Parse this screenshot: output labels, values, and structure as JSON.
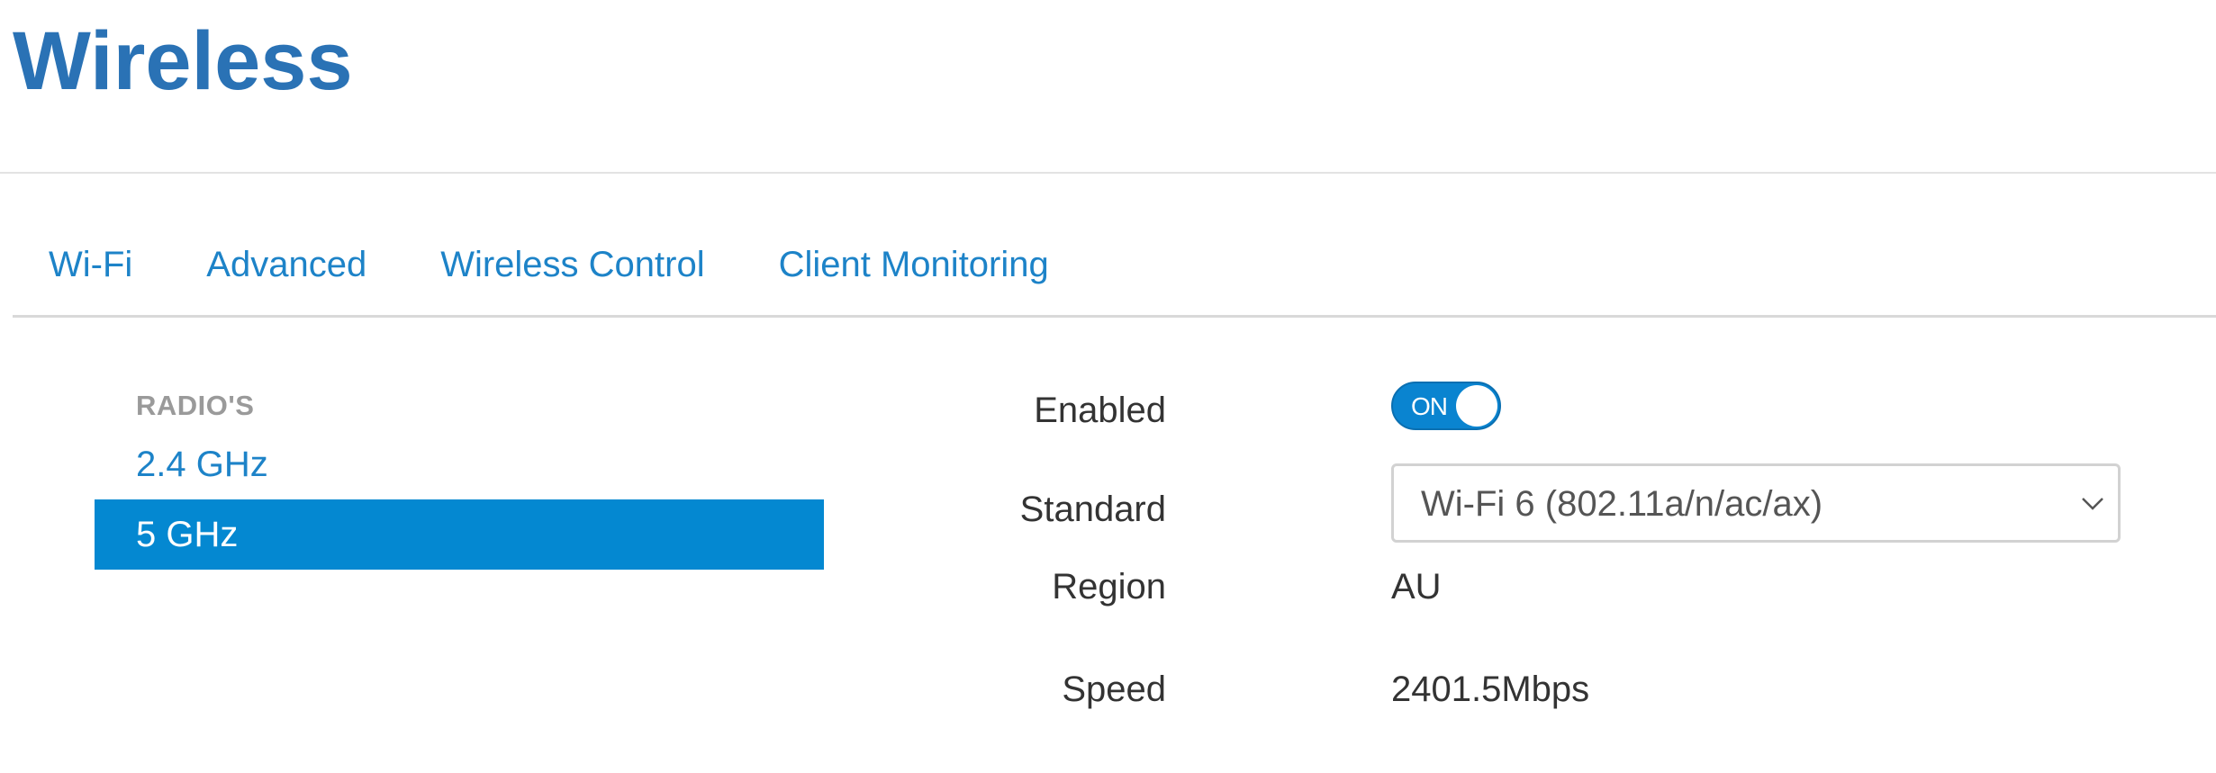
{
  "page": {
    "title": "Wireless"
  },
  "tabs": [
    {
      "label": "Wi-Fi"
    },
    {
      "label": "Advanced"
    },
    {
      "label": "Wireless Control"
    },
    {
      "label": "Client Monitoring"
    }
  ],
  "radios": {
    "heading": "RADIO'S",
    "items": [
      {
        "label": "2.4 GHz",
        "selected": false
      },
      {
        "label": "5 GHz",
        "selected": true
      }
    ]
  },
  "form": {
    "enabled": {
      "label": "Enabled",
      "state": "ON"
    },
    "standard": {
      "label": "Standard",
      "value": "Wi-Fi 6 (802.11a/n/ac/ax)",
      "icon": "chevron-down-icon"
    },
    "region": {
      "label": "Region",
      "value": "AU"
    },
    "speed": {
      "label": "Speed",
      "value": "2401.5Mbps"
    }
  },
  "colors": {
    "title": "#2a72b5",
    "link": "#1d83c8",
    "active_bg": "#0488d1",
    "toggle_bg": "#0a84d0"
  }
}
